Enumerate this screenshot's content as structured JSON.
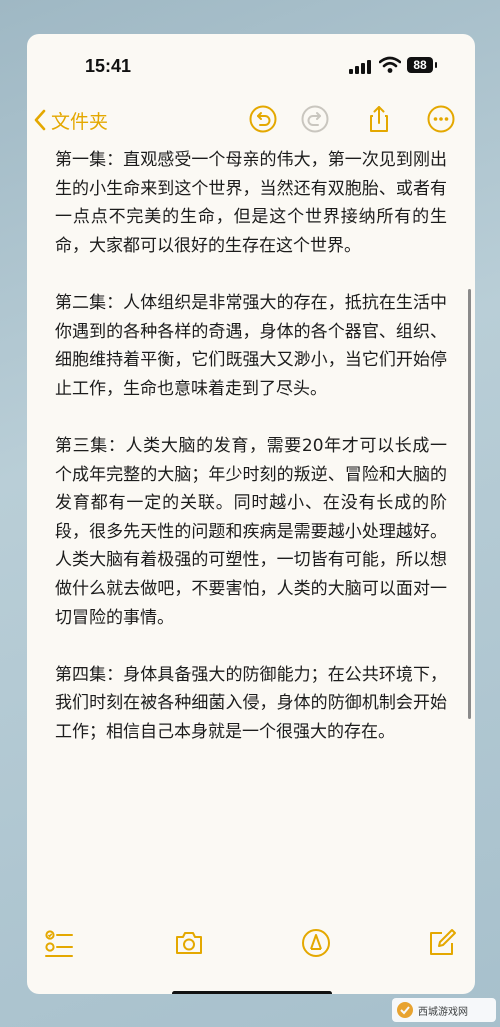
{
  "status_bar": {
    "time": "15:41",
    "battery": "88"
  },
  "nav": {
    "back_label": "文件夹",
    "accent_color": "#e4a800",
    "icons": [
      "undo-icon",
      "redo-icon",
      "share-icon",
      "more-icon"
    ]
  },
  "note": {
    "paragraphs": [
      "第一集：直观感受一个母亲的伟大，第一次见到刚出生的小生命来到这个世界，当然还有双胞胎、或者有一点点不完美的生命，但是这个世界接纳所有的生命，大家都可以很好的生存在这个世界。",
      "第二集：人体组织是非常强大的存在，抵抗在生活中你遇到的各种各样的奇遇，身体的各个器官、组织、细胞维持着平衡，它们既强大又渺小，当它们开始停止工作，生命也意味着走到了尽头。",
      "第三集：人类大脑的发育，需要20年才可以长成一个成年完整的大脑；年少时刻的叛逆、冒险和大脑的发育都有一定的关联。同时越小、在没有长成的阶段，很多先天性的问题和疾病是需要越小处理越好。人类大脑有着极强的可塑性，一切皆有可能，所以想做什么就去做吧，不要害怕，人类的大脑可以面对一切冒险的事情。",
      "第四集：身体具备强大的防御能力；在公共环境下，我们时刻在被各种细菌入侵，身体的防御机制会开始工作；相信自己本身就是一个很强大的存在。"
    ]
  },
  "toolbar": {
    "icons": [
      "checklist-icon",
      "camera-icon",
      "markup-pen-icon",
      "compose-icon"
    ]
  },
  "watermark": {
    "text": "西城游戏网"
  }
}
